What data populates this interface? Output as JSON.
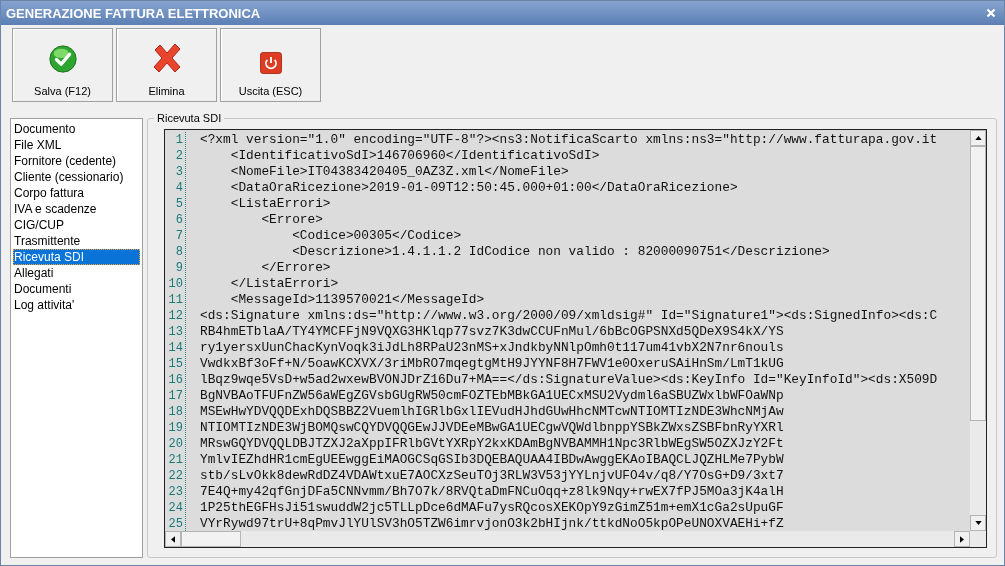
{
  "window": {
    "title": "GENERAZIONE FATTURA ELETTRONICA"
  },
  "toolbar": [
    {
      "label": "Salva (F12)",
      "kind": "save"
    },
    {
      "label": "Elimina",
      "kind": "delete"
    },
    {
      "label": "Uscita (ESC)",
      "kind": "exit"
    }
  ],
  "sidebar": {
    "items": [
      {
        "label": "Documento",
        "selected": false
      },
      {
        "label": "File XML",
        "selected": false
      },
      {
        "label": "Fornitore (cedente)",
        "selected": false
      },
      {
        "label": "Cliente (cessionario)",
        "selected": false
      },
      {
        "label": "Corpo fattura",
        "selected": false
      },
      {
        "label": "IVA e scadenze",
        "selected": false
      },
      {
        "label": "CIG/CUP",
        "selected": false
      },
      {
        "label": "Trasmittente",
        "selected": false
      },
      {
        "label": "Ricevuta SDI",
        "selected": true
      },
      {
        "label": "Allegati",
        "selected": false
      },
      {
        "label": "Documenti",
        "selected": false
      },
      {
        "label": "Log attivita'",
        "selected": false
      }
    ]
  },
  "panel": {
    "title": "Ricevuta SDI",
    "lines": [
      {
        "number": "1",
        "text": "<?xml version=\"1.0\" encoding=\"UTF-8\"?><ns3:NotificaScarto xmlns:ns3=\"http://www.fatturapa.gov.it"
      },
      {
        "number": "2",
        "text": "    <IdentificativoSdI>146706960</IdentificativoSdI>"
      },
      {
        "number": "3",
        "text": "    <NomeFile>IT04383420405_0AZ3Z.xml</NomeFile>"
      },
      {
        "number": "4",
        "text": "    <DataOraRicezione>2019-01-09T12:50:45.000+01:00</DataOraRicezione>"
      },
      {
        "number": "5",
        "text": "    <ListaErrori>"
      },
      {
        "number": "6",
        "text": "        <Errore>"
      },
      {
        "number": "7",
        "text": "            <Codice>00305</Codice>"
      },
      {
        "number": "8",
        "text": "            <Descrizione>1.4.1.1.2 IdCodice non valido : 82000090751</Descrizione>"
      },
      {
        "number": "9",
        "text": "        </Errore>"
      },
      {
        "number": "10",
        "text": "    </ListaErrori>"
      },
      {
        "number": "11",
        "text": "    <MessageId>1139570021</MessageId>"
      },
      {
        "number": "12",
        "text": "<ds:Signature xmlns:ds=\"http://www.w3.org/2000/09/xmldsig#\" Id=\"Signature1\"><ds:SignedInfo><ds:C"
      },
      {
        "number": "13",
        "text": "RB4hmETblaA/TY4YMCFFjN9VQXG3HKlqp77svz7K3dwCCUFnMul/6bBcOGPSNXd5QDeX9S4kX/YS"
      },
      {
        "number": "14",
        "text": "ry1yersxUunChacKynVoqk3iJdLh8RPaU23nMS+xJndkbyNNlpOmh0t117um41vbX2N7nr6nouls"
      },
      {
        "number": "15",
        "text": "VwdkxBf3oFf+N/5oawKCXVX/3riMbRO7mqegtgMtH9JYYNF8H7FWV1e0OxeruSAiHnSm/LmT1kUG"
      },
      {
        "number": "16",
        "text": "lBqz9wqe5VsD+w5ad2wxewBVONJDrZ16Du7+MA==</ds:SignatureValue><ds:KeyInfo Id=\"KeyInfoId\"><ds:X509D"
      },
      {
        "number": "17",
        "text": "BgNVBAoTFUFnZW56aWEgZGVsbGUgRW50cmFOZTEbMBkGA1UECxMSU2Vydml6aSBUZWxlbWFOaWNp"
      },
      {
        "number": "18",
        "text": "MSEwHwYDVQQDExhDQSBBZ2VuemlhIGRlbGxlIEVudHJhdGUwHhcNMTcwNTIOMTIzNDE3WhcNMjAw"
      },
      {
        "number": "19",
        "text": "NTIOMTIzNDE3WjBOMQswCQYDVQQGEwJJVDEeMBwGA1UECgwVQWdlbnppYSBkZWxsZSBFbnRyYXRl"
      },
      {
        "number": "20",
        "text": "MRswGQYDVQQLDBJTZXJ2aXppIFRlbGVtYXRpY2kxKDAmBgNVBAMMH1Npc3RlbWEgSW5OZXJzY2Ft"
      },
      {
        "number": "21",
        "text": "YmlvIEZhdHR1cmEgUEEwggEiMAOGCSqGSIb3DQEBAQUAA4IBDwAwggEKAoIBAQCLJQZHLMe7PybW"
      },
      {
        "number": "22",
        "text": "stb/sLvOkk8dewRdDZ4VDAWtxuE7AOCXzSeuTOj3RLW3V53jYYLnjvUFO4v/q8/Y7OsG+D9/3xt7"
      },
      {
        "number": "23",
        "text": "7E4Q+my42qfGnjDFa5CNNvmm/Bh7O7k/8RVQtaDmFNCuOqq+z8lk9Nqy+rwEX7fPJ5MOa3jK4alH"
      },
      {
        "number": "24",
        "text": "1P25thEGFHsJi51swuddW2jc5TLLpDce6dMAFu7ysRQcosXEKOpY9zGimZ51m+emX1cGa2sUpuGF"
      },
      {
        "number": "25",
        "text": "VYrRywd97trU+8qPmvJlYUlSV3hO5TZW6imrvjonO3k2bHIjnk/ttkdNoO5kpOPeUNOXVAEHi+fZ"
      }
    ]
  }
}
